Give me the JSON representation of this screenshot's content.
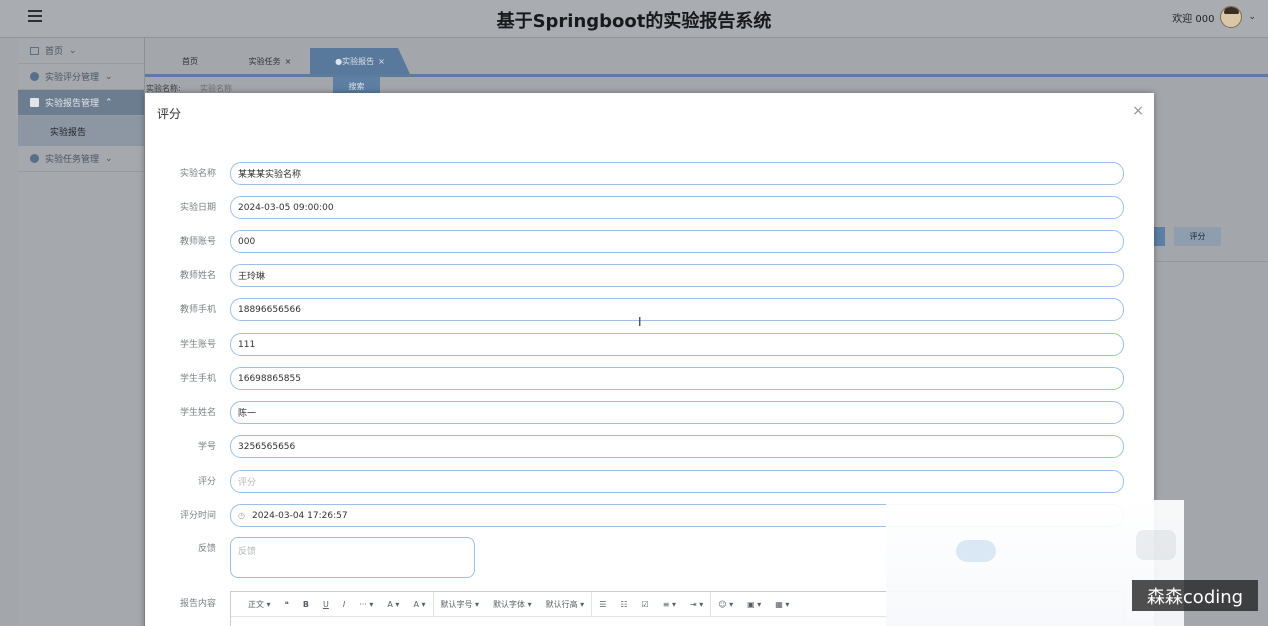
{
  "app": {
    "title": "基于Springboot的实验报告系统",
    "user_greeting": "欢迎 000"
  },
  "sidebar": {
    "items": [
      {
        "label": "首页",
        "icon": "home-icon"
      },
      {
        "label": "实验评分管理",
        "icon": "circle-icon"
      },
      {
        "label": "实验报告管理",
        "icon": "square-icon"
      },
      {
        "label": "实验报告",
        "sub": true
      },
      {
        "label": "实验任务管理",
        "icon": "circle-icon"
      }
    ]
  },
  "tabs": [
    {
      "label": "首页"
    },
    {
      "label": "实验任务",
      "close": "×"
    },
    {
      "label": "●实验报告",
      "close": "×",
      "active": true
    }
  ],
  "search": {
    "label": "实验名称:",
    "placeholder": "实验名称",
    "button": "搜索"
  },
  "background_buttons": {
    "rate": "评分"
  },
  "modal": {
    "title": "评分",
    "close": "×",
    "fields": [
      {
        "label": "实验名称",
        "value": "某某某实验名称"
      },
      {
        "label": "实验日期",
        "value": "2024-03-05 09:00:00"
      },
      {
        "label": "教师账号",
        "value": "000"
      },
      {
        "label": "教师姓名",
        "value": "王玲琳"
      },
      {
        "label": "教师手机",
        "value": "18896656566"
      },
      {
        "label": "学生账号",
        "value": "111"
      },
      {
        "label": "学生手机",
        "value": "16698865855"
      },
      {
        "label": "学生姓名",
        "value": "陈一"
      },
      {
        "label": "学号",
        "value": "3256565656"
      },
      {
        "label": "评分",
        "placeholder": "评分"
      },
      {
        "label": "评分时间",
        "value": "2024-03-04 17:26:57",
        "icon": "clock-icon"
      }
    ],
    "feedback": {
      "label": "反馈",
      "placeholder": "反馈"
    },
    "report": {
      "label": "报告内容",
      "toolbar": [
        "正文",
        "❝",
        "B",
        "U",
        "I",
        "···",
        "A",
        "A",
        "默认字号",
        "默认字体",
        "默认行高",
        "☰",
        "☷",
        "☑",
        "≡",
        "⇥",
        "☺",
        "▣",
        "▦"
      ]
    }
  },
  "watermark": "森森coding"
}
